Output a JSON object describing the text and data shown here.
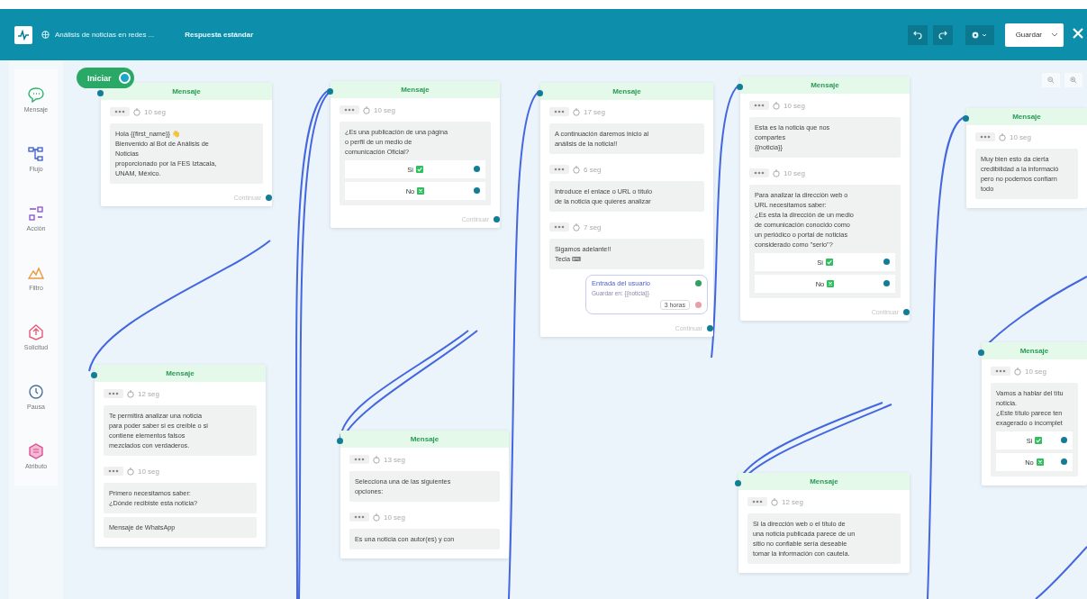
{
  "header": {
    "flow_name": "Análisis de noticias en redes ...",
    "subtitle": "Respuesta estándar",
    "save_label": "Guardar"
  },
  "sidebar": {
    "items": [
      {
        "label": "Mensaje"
      },
      {
        "label": "Flujo"
      },
      {
        "label": "Acción"
      },
      {
        "label": "Filtro"
      },
      {
        "label": "Solicitud"
      },
      {
        "label": "Pausa"
      },
      {
        "label": "Atributo"
      }
    ]
  },
  "start": {
    "label": "Iniciar"
  },
  "nodes": [
    {
      "title": "Mensaje",
      "footer": "Continuar",
      "blocks": [
        {
          "kind": "delay",
          "text": "10 seg"
        },
        {
          "kind": "text",
          "text": "Hola {{first_name}} 👋\nBienvenido al Bot de Análisis de\nNoticias\nproporcionado por la FES Iztacala,\nUNAM, México."
        }
      ]
    },
    {
      "title": "Mensaje",
      "footer": "Continuar",
      "blocks": [
        {
          "kind": "delay",
          "text": "10 seg"
        },
        {
          "kind": "text",
          "text": "¿Es una publicación de una página\no perfil de un medio de\ncomunicación Oficial?",
          "buttons": [
            {
              "label": "Si",
              "kind": "yes"
            },
            {
              "label": "No",
              "kind": "no"
            }
          ]
        }
      ]
    },
    {
      "title": "Mensaje",
      "footer": "Continuar",
      "blocks": [
        {
          "kind": "delay",
          "text": "17 seg"
        },
        {
          "kind": "text",
          "text": "A continuación daremos inicio al\nanálisis de la noticia!!"
        },
        {
          "kind": "delay",
          "text": "6 seg"
        },
        {
          "kind": "text",
          "text": "Introduce el enlace o URL o título\nde la noticia que quieres analizar"
        },
        {
          "kind": "delay",
          "text": "7 seg"
        },
        {
          "kind": "text",
          "text": "Sigamos adelante!!\nTecla ⌨"
        },
        {
          "kind": "input",
          "title": "Entrada del usuario",
          "variable": "Guardar en: {{noticia}}",
          "timeout": "3 horas"
        }
      ]
    },
    {
      "title": "Mensaje",
      "footer": "Continuar",
      "blocks": [
        {
          "kind": "delay",
          "text": "10 seg"
        },
        {
          "kind": "text",
          "text": "Esta es la noticia que nos\ncompartes\n{{noticia}}"
        },
        {
          "kind": "delay",
          "text": "10 seg"
        },
        {
          "kind": "text",
          "text": "Para analizar la dirección web o\nURL necesitamos saber:\n¿Es esta la dirección de un medio\nde comunicación conocido como\nun periódico o portal de noticias\nconsiderado como \"serio\"?",
          "buttons": [
            {
              "label": "Si",
              "kind": "yes"
            },
            {
              "label": "No",
              "kind": "no"
            }
          ]
        }
      ]
    },
    {
      "title": "Mensaje",
      "blocks": [
        {
          "kind": "delay",
          "text": "10 seg"
        },
        {
          "kind": "text",
          "text": "Muy bien esto da cierta\ncredibilidad a la informació\npero no podemos confiarn\ntodo"
        }
      ]
    },
    {
      "title": "Mensaje",
      "blocks": [
        {
          "kind": "delay",
          "text": "10 seg"
        },
        {
          "kind": "text",
          "text": "Vamos a hablar del títu\nnoticia.\n¿Este título parece ten\nexagerado o incomplet",
          "buttons": [
            {
              "label": "Si",
              "kind": "yes"
            },
            {
              "label": "No",
              "kind": "no"
            }
          ]
        }
      ]
    },
    {
      "title": "Mensaje",
      "blocks": [
        {
          "kind": "delay",
          "text": "12 seg"
        },
        {
          "kind": "text",
          "text": "Te permitirá analizar una noticia\npara poder saber si es creíble o si\ncontiene elementos falsos\nmezclados con verdaderos."
        },
        {
          "kind": "delay",
          "text": "10 seg"
        },
        {
          "kind": "text",
          "text": "Primero necesitamos saber:\n¿Dónde recibiste esta noticia?"
        },
        {
          "kind": "text",
          "text": "Mensaje de WhatsApp"
        }
      ]
    },
    {
      "title": "Mensaje",
      "blocks": [
        {
          "kind": "delay",
          "text": "13 seg"
        },
        {
          "kind": "text",
          "text": "Selecciona una de las siguientes\nopciones:"
        },
        {
          "kind": "delay",
          "text": "10 seg"
        },
        {
          "kind": "text",
          "text": "Es una noticia con autor(es) y con"
        }
      ]
    },
    {
      "title": "Mensaje",
      "blocks": [
        {
          "kind": "delay",
          "text": "12 seg"
        },
        {
          "kind": "text",
          "text": "Si la dirección web o el título de\nuna noticia publicada parece de un\nsitio no confiable sería deseable\ntomar la información con cautela."
        }
      ]
    }
  ]
}
